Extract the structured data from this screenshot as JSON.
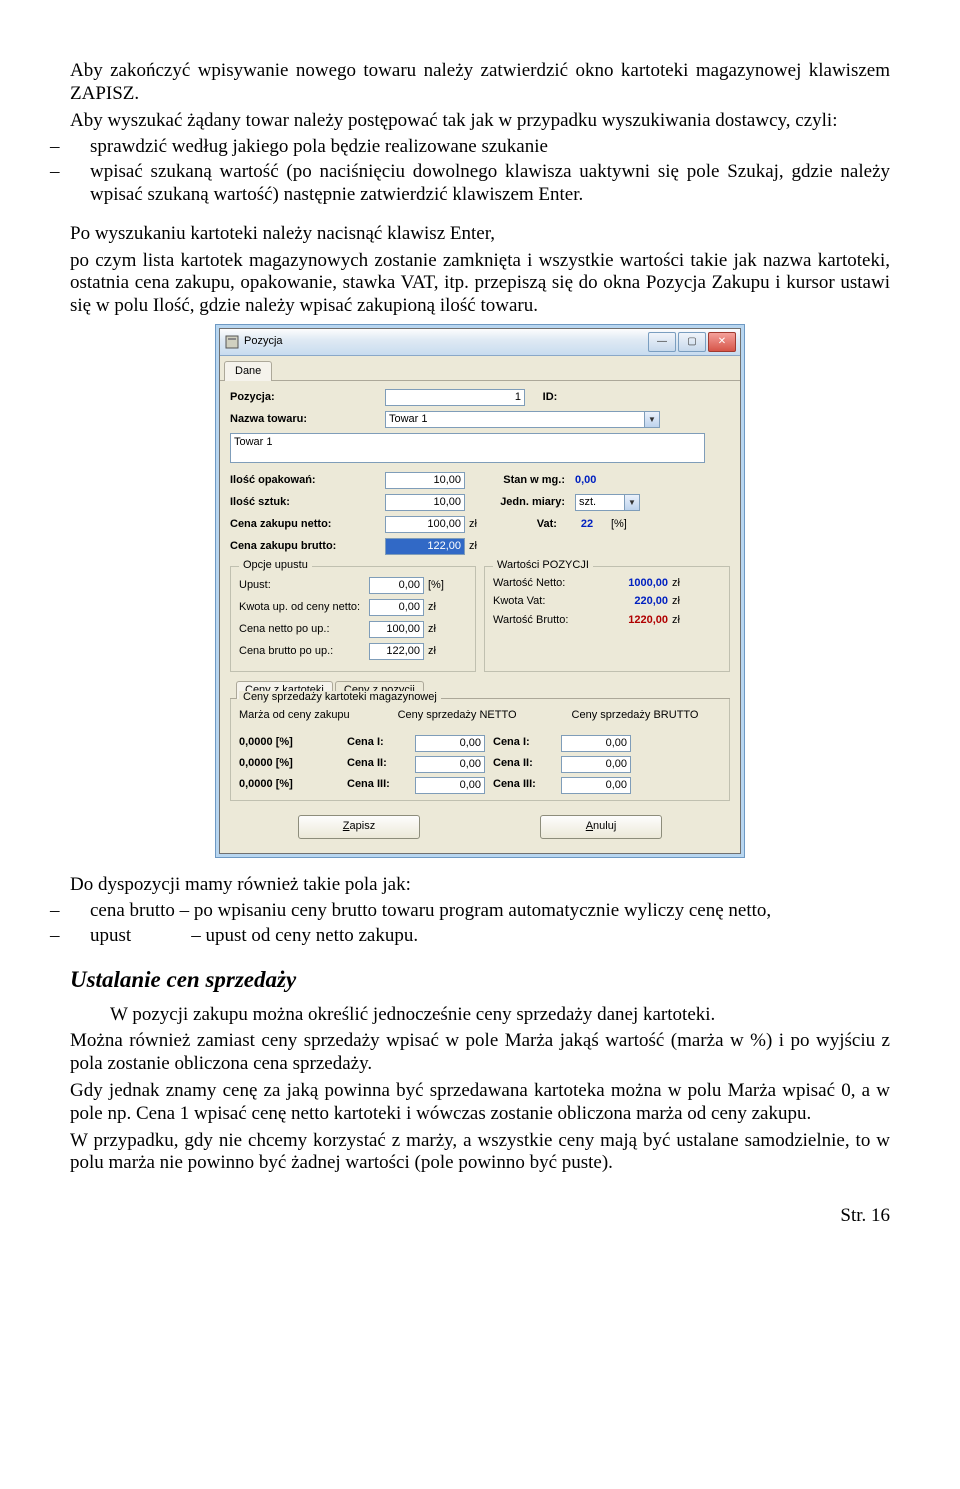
{
  "doc": {
    "p1": "Aby zakończyć wpisywanie nowego towaru należy zatwierdzić okno kartoteki magazynowej klawiszem ZAPISZ.",
    "p2": "Aby wyszukać żądany towar należy postępować tak jak w przypadku wyszukiwania dostawcy, czyli:",
    "li1": "sprawdzić według jakiego pola będzie realizowane szukanie",
    "li2": "wpisać szukaną wartość (po naciśnięciu dowolnego klawisza uaktywni się pole Szukaj, gdzie należy wpisać szukaną wartość) następnie zatwierdzić klawiszem Enter.",
    "p3": "Po wyszukaniu kartoteki należy nacisnąć klawisz Enter,",
    "p4": "po czym lista kartotek magazynowych zostanie zamknięta i wszystkie wartości takie jak nazwa kartoteki, ostatnia cena zakupu, opakowanie, stawka VAT, itp. przepiszą się do okna Pozycja Zakupu i kursor ustawi się w polu Ilość, gdzie należy wpisać zakupioną ilość towaru.",
    "p5": "Do dyspozycji mamy również takie pola jak:",
    "li3": "cena brutto – po wpisaniu ceny brutto towaru program automatycznie wyliczy cenę netto,",
    "li4a": "upust",
    "li4b": "– upust od ceny netto zakupu.",
    "h2": "Ustalanie cen sprzedaży",
    "p6": "W pozycji zakupu można określić jednocześnie ceny sprzedaży danej kartoteki.",
    "p7": "Można również zamiast ceny sprzedaży wpisać w pole Marża jakąś wartość (marża w %) i po wyjściu z pola zostanie obliczona cena sprzedaży.",
    "p8": "Gdy jednak znamy cenę za jaką powinna być sprzedawana kartoteka można w polu Marża wpisać 0, a w pole np. Cena 1 wpisać cenę netto kartoteki i wówczas zostanie obliczona marża od ceny zakupu.",
    "p9": "W przypadku, gdy nie chcemy korzystać z marży, a wszystkie ceny mają być ustalane samodzielnie, to w polu marża nie powinno być żadnej wartości (pole powinno być puste).",
    "pagenum": "Str. 16"
  },
  "dialog": {
    "title": "Pozycja",
    "tab_dane": "Dane",
    "lbl_pozycja": "Pozycja:",
    "val_pozycja": "1",
    "lbl_id": "ID:",
    "lbl_nazwa": "Nazwa towaru:",
    "val_nazwa": "Towar 1",
    "list_item": "Towar 1",
    "lbl_ilosc_op": "Ilość opakowań:",
    "val_ilosc_op": "10,00",
    "lbl_stan": "Stan w mg.:",
    "val_stan": "0,00",
    "lbl_ilosc_szt": "Ilość sztuk:",
    "val_ilosc_szt": "10,00",
    "lbl_jedn": "Jedn. miary:",
    "val_jedn": "szt.",
    "lbl_cena_netto": "Cena zakupu netto:",
    "val_cena_netto": "100,00",
    "unit_zl": "zł",
    "lbl_vat": "Vat:",
    "val_vat": "22",
    "unit_pct": "[%]",
    "lbl_cena_brutto": "Cena zakupu brutto:",
    "val_cena_brutto": "122,00",
    "grp_opcje": "Opcje upustu",
    "lbl_upust": "Upust:",
    "val_upust": "0,00",
    "lbl_kwota_up": "Kwota up. od ceny netto:",
    "val_kwota_up": "0,00",
    "lbl_cn_po": "Cena netto po up.:",
    "val_cn_po": "100,00",
    "lbl_cb_po": "Cena brutto po up.:",
    "val_cb_po": "122,00",
    "grp_wart": "Wartości POZYCJI",
    "lbl_wn": "Wartość Netto:",
    "val_wn": "1000,00",
    "lbl_kv": "Kwota Vat:",
    "val_kv": "220,00",
    "lbl_wb": "Wartość Brutto:",
    "val_wb": "1220,00",
    "tab_ck": "Ceny z kartoteki",
    "tab_cp": "Ceny z pozycji",
    "grp_ceny": "Ceny sprzedaży kartoteki magazynowej",
    "hdr_marza": "Marża od ceny zakupu",
    "hdr_netto": "Ceny sprzedaży NETTO",
    "hdr_brutto": "Ceny sprzedaży BRUTTO",
    "marza": "0,0000 [%]",
    "cena1": "Cena I:",
    "cena2": "Cena II:",
    "cena3": "Cena III:",
    "cena_val": "0,00",
    "btn_zapisz_pre": "Z",
    "btn_zapisz": "apisz",
    "btn_anuluj_pre": "A",
    "btn_anuluj": "nuluj"
  }
}
